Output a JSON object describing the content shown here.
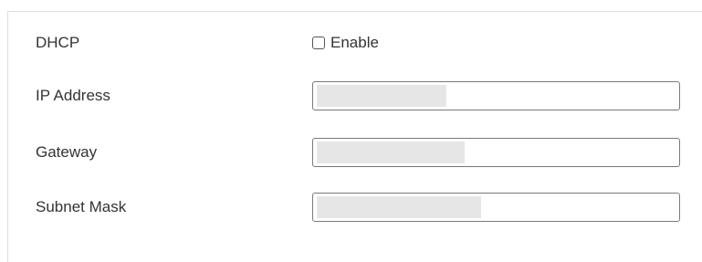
{
  "network_settings": {
    "dhcp": {
      "label": "DHCP",
      "checkbox_label": "Enable",
      "checked": false
    },
    "fields": [
      {
        "label": "IP Address",
        "value": ""
      },
      {
        "label": "Gateway",
        "value": ""
      },
      {
        "label": "Subnet Mask",
        "value": ""
      }
    ]
  }
}
